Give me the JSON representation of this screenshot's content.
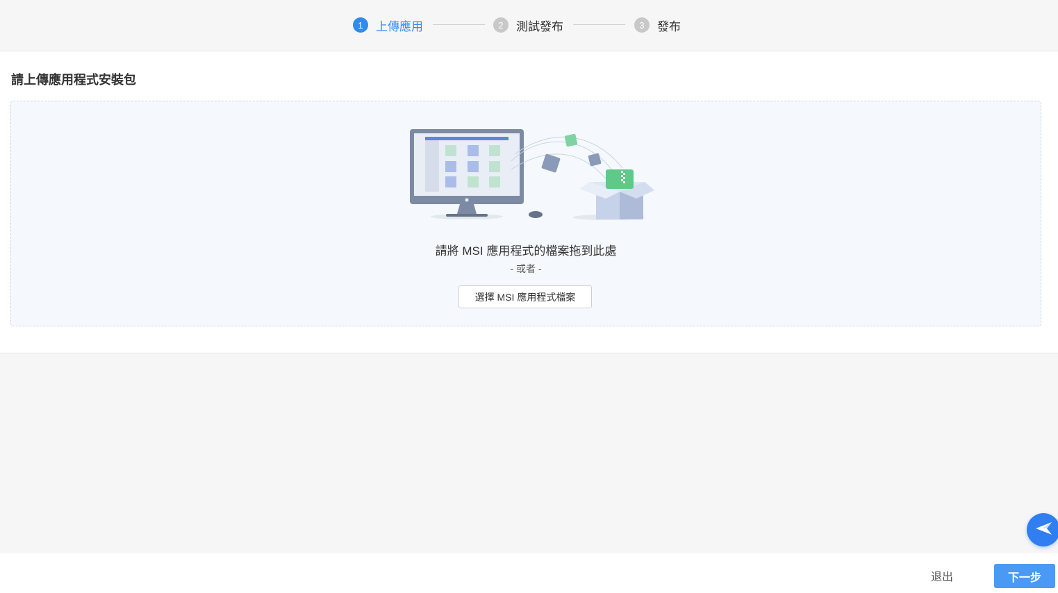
{
  "stepper": {
    "steps": [
      {
        "num": "1",
        "label": "上傳應用"
      },
      {
        "num": "2",
        "label": "測試發布"
      },
      {
        "num": "3",
        "label": "發布"
      }
    ]
  },
  "upload": {
    "title": "請上傳應用程式安裝包",
    "drop_text": "請將 MSI 應用程式的檔案拖到此處",
    "or_text": "- 或者 -",
    "choose_button": "選擇 MSI 應用程式檔案"
  },
  "footer": {
    "exit_label": "退出",
    "next_label": "下一步"
  },
  "icons": {
    "fab": "send-plane-icon",
    "illustration": "computer-to-box-upload-illustration"
  },
  "colors": {
    "accent": "#2f8bf0",
    "next_button": "#4a9af5",
    "fab": "#2f7ef2",
    "dropzone_bg": "#f5f9fd"
  }
}
